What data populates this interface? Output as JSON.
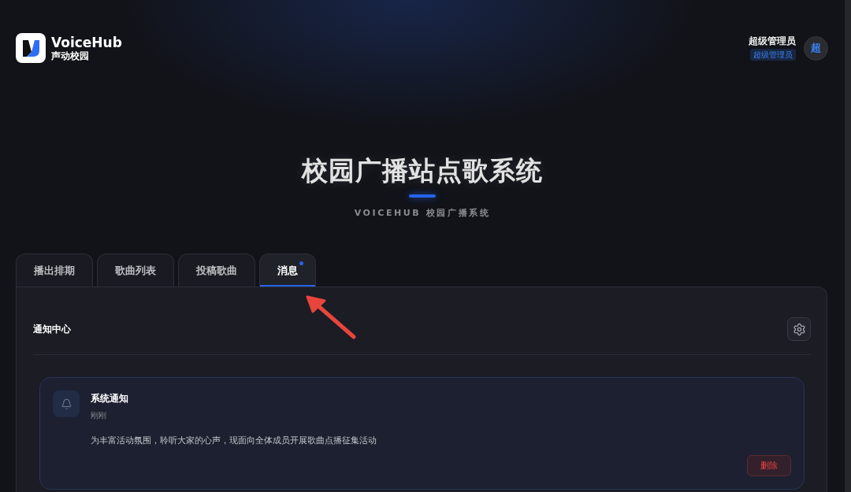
{
  "header": {
    "brand": {
      "name": "VoiceHub",
      "tagline": "声动校园"
    },
    "user": {
      "name": "超级管理员",
      "role": "超级管理员",
      "avatar_initial": "超"
    }
  },
  "hero": {
    "title": "校园广播站点歌系统",
    "subtitle": "VOICEHUB 校园广播系统"
  },
  "tabs": [
    {
      "label": "播出排期",
      "selected": false,
      "unread": false
    },
    {
      "label": "歌曲列表",
      "selected": false,
      "unread": false
    },
    {
      "label": "投稿歌曲",
      "selected": false,
      "unread": false
    },
    {
      "label": "消息",
      "selected": true,
      "unread": true
    }
  ],
  "panel": {
    "title": "通知中心",
    "notifications": [
      {
        "title": "系统通知",
        "time": "刚刚",
        "message": "为丰富活动氛围，聆听大家的心声，现面向全体成员开展歌曲点播征集活动",
        "action": "删除"
      }
    ]
  }
}
